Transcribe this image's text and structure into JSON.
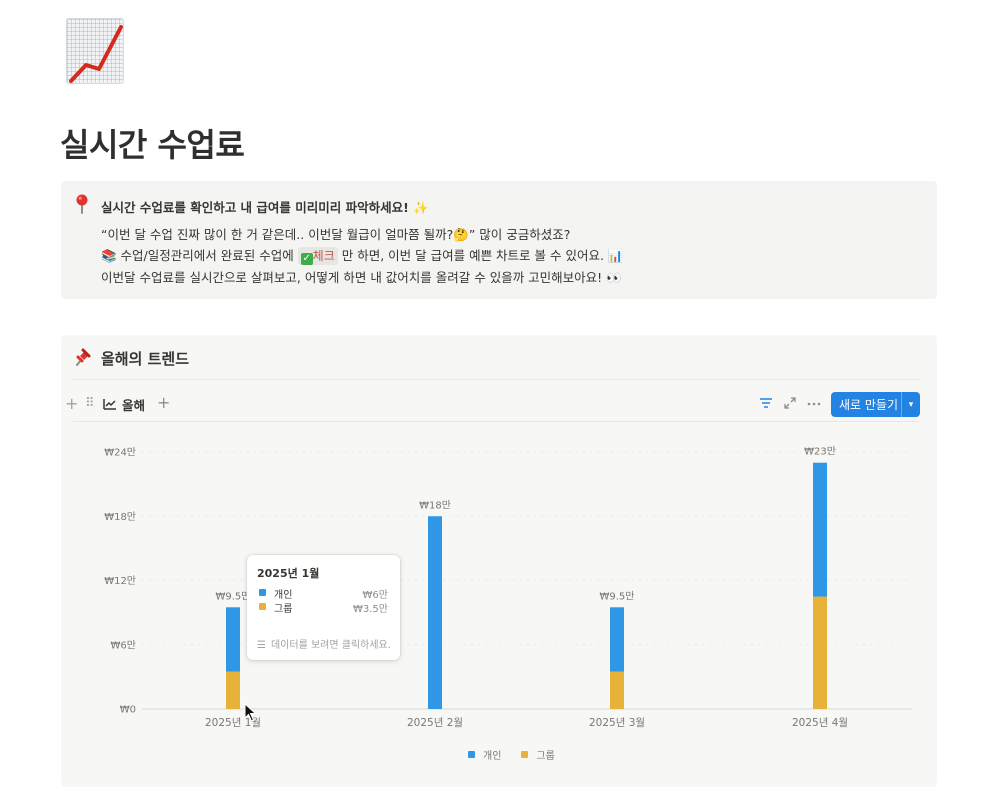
{
  "page": {
    "title": "실시간 수업료"
  },
  "callout": {
    "headline": "실시간 수업료를 확인하고 내 급여를 미리미리 파악하세요! ✨",
    "line1": "“이번 달 수업 진짜 많이 한 거 같은데.. 이번달 월급이 얼마쯤 될까?🤔” 많이 궁금하셨죠?",
    "line2_prefix": "📚 수업/일정관리에서 완료된 수업에 ",
    "line2_tag": "체크",
    "line2_suffix": " 만 하면, 이번 달 급여를 예쁜 차트로 볼 수 있어요. 📊",
    "line3": "이번달 수업료를 실시간으로 살펴보고, 어떻게 하면 내 값어치를 올려갈 수 있을까 고민해보아요! 👀"
  },
  "section": {
    "title": "올해의 트렌드"
  },
  "toolbar": {
    "view_label": "올해",
    "new_button_label": "새로 만들기"
  },
  "colors": {
    "personal": "#2f97e6",
    "group": "#e6b23a",
    "accent": "#2383e2"
  },
  "chart_data": {
    "type": "bar",
    "stacked": true,
    "categories": [
      "2025년 1월",
      "2025년 2월",
      "2025년 3월",
      "2025년 4월"
    ],
    "series": [
      {
        "name": "개인",
        "values": [
          60000,
          180000,
          60000,
          125000
        ]
      },
      {
        "name": "그룹",
        "values": [
          35000,
          0,
          35000,
          105000
        ]
      }
    ],
    "total_labels": [
      "₩9.5만",
      "₩18만",
      "₩9.5만",
      "₩23만"
    ],
    "y_ticks": [
      {
        "value": 0,
        "label": "₩0"
      },
      {
        "value": 60000,
        "label": "₩6만"
      },
      {
        "value": 120000,
        "label": "₩12만"
      },
      {
        "value": 180000,
        "label": "₩18만"
      },
      {
        "value": 240000,
        "label": "₩24만"
      }
    ],
    "ylim": [
      0,
      240000
    ],
    "grid": true,
    "legend": "bottom"
  },
  "tooltip": {
    "title": "2025년 1월",
    "rows": [
      {
        "name": "개인",
        "value": "₩6만"
      },
      {
        "name": "그룹",
        "value": "₩3.5만"
      }
    ],
    "hint": "데이터를 보려면 클릭하세요."
  }
}
